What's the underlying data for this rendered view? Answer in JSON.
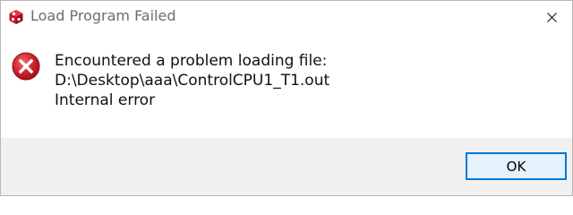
{
  "window": {
    "title": "Load Program Failed",
    "app_icon": "ccs-cube-icon",
    "close_icon": "close-icon"
  },
  "message": {
    "icon": "error-icon",
    "line1": "Encountered a problem loading file:",
    "line2": "D:\\Desktop\\aaa\\ControlCPU1_T1.out",
    "line3": "Internal error"
  },
  "buttons": {
    "ok_label": "OK"
  },
  "colors": {
    "error_red": "#d1232e",
    "app_icon_red": "#c8102e",
    "button_border": "#0078d7",
    "button_fill": "#e5f1fb"
  }
}
